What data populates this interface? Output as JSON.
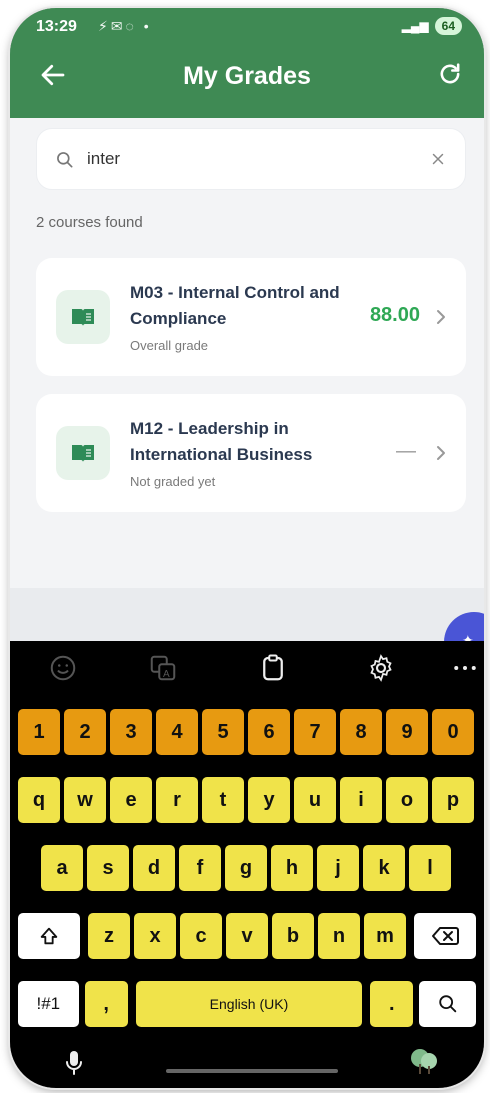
{
  "status_bar": {
    "time": "13:29",
    "battery": "64"
  },
  "app_bar": {
    "title": "My Grades"
  },
  "search": {
    "value": "inter"
  },
  "results": {
    "count_label": "2 courses found"
  },
  "courses": [
    {
      "title": "M03 - Internal Control and Compliance",
      "subtitle": "Overall grade",
      "grade": "88.00"
    },
    {
      "title": "M12 - Leadership in International Business",
      "subtitle": "Not graded yet",
      "grade": "—"
    }
  ],
  "keyboard": {
    "number_row": [
      "1",
      "2",
      "3",
      "4",
      "5",
      "6",
      "7",
      "8",
      "9",
      "0"
    ],
    "row1": [
      "q",
      "w",
      "e",
      "r",
      "t",
      "y",
      "u",
      "i",
      "o",
      "p"
    ],
    "row2": [
      "a",
      "s",
      "d",
      "f",
      "g",
      "h",
      "j",
      "k",
      "l"
    ],
    "row3": [
      "z",
      "x",
      "c",
      "v",
      "b",
      "n",
      "m"
    ],
    "symbols_label": "!#1",
    "comma": ",",
    "space_label": "English (UK)",
    "period": "."
  },
  "colors": {
    "app_bar": "#3f8a54",
    "grade_green": "#2fa855",
    "number_keys": "#e79a11",
    "letter_keys": "#f0e34a",
    "fab": "#4a55d6"
  }
}
